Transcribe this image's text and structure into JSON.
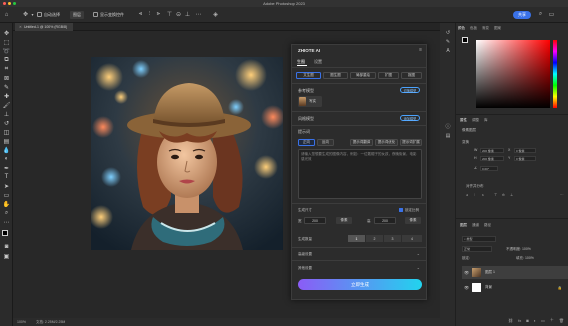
{
  "window": {
    "title": "Adobe Photoshop 2023"
  },
  "options_bar": {
    "auto_select_label": "自动选择",
    "layer_select_value": "图层",
    "show_transform_label": "显示变换控件",
    "share_label": "共享"
  },
  "document": {
    "tab_label": "Untitled-1 @ 100% (RGB/8)"
  },
  "status_bar": {
    "zoom": "100%",
    "info": "文档: 2.25M/2.25M"
  },
  "plugin": {
    "title": "ZHIOTE AI",
    "tabs": [
      {
        "label": "生图"
      },
      {
        "label": "设置"
      }
    ],
    "features": [
      {
        "label": "文生图"
      },
      {
        "label": "图生图"
      },
      {
        "label": "局部重绘"
      },
      {
        "label": "扩图"
      },
      {
        "label": "抠图"
      }
    ],
    "model_section": {
      "label": "参考模型",
      "action": "切换模型",
      "chip_label": "写实"
    },
    "lora_section": {
      "label": "风格模型",
      "action": "添加模型"
    },
    "prompt_section": {
      "label": "提示词",
      "tabs": [
        {
          "label": "正向"
        },
        {
          "label": "反向"
        },
        {
          "label": "提示词翻译"
        },
        {
          "label": "提示词优化"
        },
        {
          "label": "提示词扩展"
        }
      ],
      "placeholder": "请输入您想要生成的图像内容，例如：一位戴帽子的女孩，夜晚街景，电影感光效"
    },
    "size": {
      "label": "生成尺寸",
      "lock_label": "锁定比例",
      "width_label": "宽",
      "width_value": "200",
      "height_label": "高",
      "height_value": "200",
      "unit": "像素"
    },
    "count": {
      "label": "生成数量",
      "options": [
        "1",
        "2",
        "3",
        "4"
      ],
      "selected": 0
    },
    "advanced": {
      "label": "高级设置"
    },
    "more": {
      "label": "其他设置"
    },
    "generate_label": "立即生成"
  },
  "right_panel": {
    "color_tabs": [
      {
        "label": "颜色"
      },
      {
        "label": "色板"
      },
      {
        "label": "渐变"
      },
      {
        "label": "图案"
      }
    ],
    "properties_tabs": [
      {
        "label": "属性"
      },
      {
        "label": "调整"
      },
      {
        "label": "库"
      }
    ],
    "properties_title": "像素图层",
    "transform_label": "变换",
    "w_value": "200 像素",
    "h_value": "200 像素",
    "x_value": "0 像素",
    "y_value": "0 像素",
    "angle_value": "0.00°",
    "align_label": "对齐并分布",
    "layers_tabs": [
      {
        "label": "图层"
      },
      {
        "label": "通道"
      },
      {
        "label": "路径"
      }
    ],
    "blend_mode": "正常",
    "opacity": "不透明度: 100%",
    "fill": "填充: 100%",
    "lock_label": "锁定:",
    "layers": [
      {
        "name": "图层 1"
      },
      {
        "name": "背景"
      }
    ]
  },
  "colors": {
    "accent_blue": "#3a72e8",
    "generate_gradient_start": "#8b5cf6",
    "generate_gradient_end": "#22d3ee"
  }
}
